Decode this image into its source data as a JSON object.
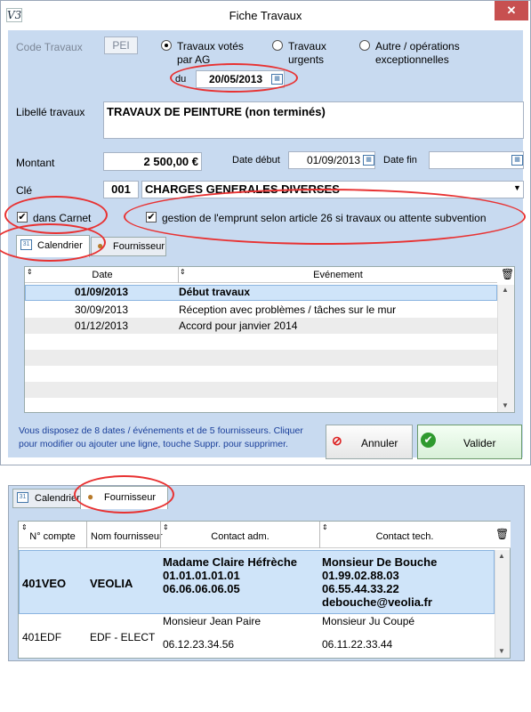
{
  "window": {
    "title": "Fiche Travaux",
    "app_icon": "V3",
    "close": "✕"
  },
  "form": {
    "code_label": "Code Travaux",
    "code_value": "PEI",
    "radio_ag": "Travaux votés\npar AG",
    "radio_urgent": "Travaux\nurgents",
    "radio_other": "Autre / opérations\nexceptionnelles",
    "du_label": "du",
    "du_value": "20/05/2013",
    "libelle_label": "Libellé travaux",
    "libelle_value": "TRAVAUX DE  PEINTURE (non terminés)",
    "montant_label": "Montant",
    "montant_value": "2 500,00 €",
    "date_debut_label": "Date début",
    "date_debut_value": "01/09/2013",
    "date_fin_label": "Date fin",
    "date_fin_value": "",
    "cle_label": "Clé",
    "cle_code": "001",
    "cle_value": "CHARGES GENERALES DIVERSES",
    "carnet_label": "dans Carnet",
    "emprunt_label": "gestion de l'emprunt selon article 26 si travaux ou attente subvention"
  },
  "tabs": {
    "calendrier": "Calendrier",
    "fournisseur": "Fournisseur"
  },
  "calendar": {
    "headers": [
      "Date",
      "Evénement"
    ],
    "rows": [
      {
        "date": "01/09/2013",
        "event": "Début travaux"
      },
      {
        "date": "30/09/2013",
        "event": "Réception avec problèmes / tâches sur le mur"
      },
      {
        "date": "01/12/2013",
        "event": "Accord pour janvier 2014"
      }
    ]
  },
  "info_text": "Vous disposez de 8 dates / événements et de 5 fournisseurs. Cliquer pour modifier ou ajouter une ligne, touche Suppr. pour supprimer.",
  "buttons": {
    "annuler": "Annuler",
    "valider": "Valider"
  },
  "panel2": {
    "tab_calendrier": "Calendrier",
    "tab_fournisseur": "Fournisseur",
    "headers": [
      "N° compte",
      "Nom fournisseur",
      "Contact adm.",
      "Contact tech."
    ],
    "rows": [
      {
        "compte": "401VEO",
        "nom": "VEOLIA",
        "adm": [
          "Madame Claire Héfrèche",
          "01.01.01.01.01",
          "06.06.06.06.05"
        ],
        "tech": [
          "Monsieur De Bouche",
          "01.99.02.88.03",
          "06.55.44.33.22",
          "debouche@veolia.fr"
        ]
      },
      {
        "compte": "401EDF",
        "nom": "EDF - ELECT",
        "adm": [
          "Monsieur Jean Paire",
          "",
          "06.12.23.34.56"
        ],
        "tech": [
          "Monsieur Ju Coupé",
          "",
          "06.11.22.33.44"
        ]
      }
    ]
  }
}
